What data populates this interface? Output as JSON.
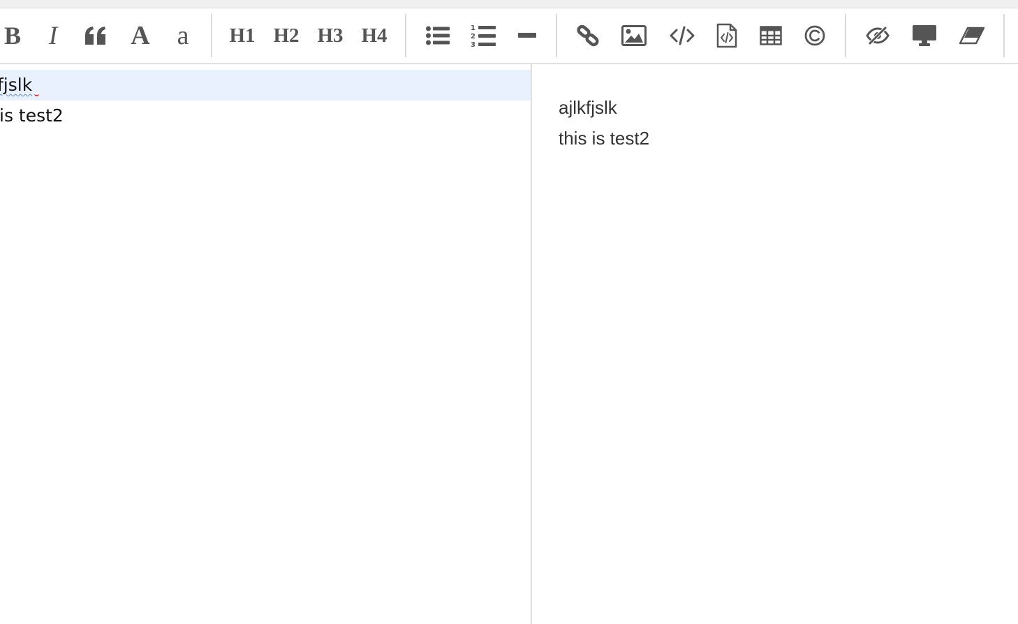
{
  "toolbar": {
    "bold_label": "B",
    "italic_label": "I",
    "uppercase_label": "A",
    "lowercase_label": "a",
    "h1_label": "H1",
    "h2_label": "H2",
    "h3_label": "H3",
    "h4_label": "H4",
    "icons": [
      "bold",
      "italic",
      "quote-icon",
      "uppercase",
      "lowercase",
      "h1",
      "h2",
      "h3",
      "h4",
      "unordered-list-icon",
      "ordered-list-icon",
      "horizontal-rule-icon",
      "link-icon",
      "image-icon",
      "code-icon",
      "code-file-icon",
      "table-icon",
      "copyright-icon",
      "preview-toggle-icon",
      "fullscreen-desktop-icon",
      "eraser-icon"
    ]
  },
  "editor": {
    "lines": [
      "fjslk",
      "is test2"
    ]
  },
  "preview": {
    "lines": [
      "ajlkfjslk",
      "this is test2"
    ]
  },
  "colors": {
    "icon": "#555555",
    "active_line": "#e8f1fd",
    "text": "#111111",
    "preview_text": "#333333",
    "separator": "#dadada"
  }
}
